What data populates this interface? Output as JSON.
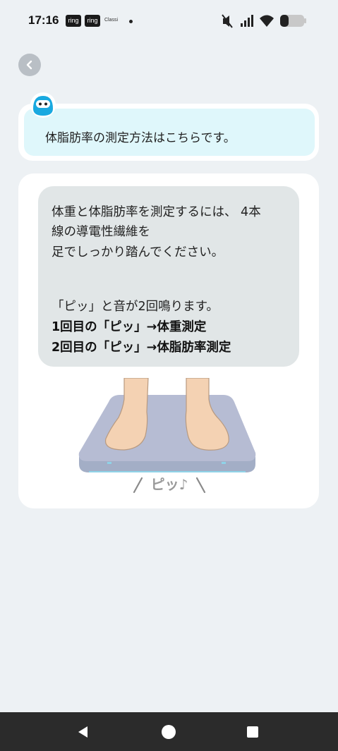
{
  "status_bar": {
    "time": "17:16",
    "badges": [
      "ring",
      "ring"
    ],
    "classi": "Classi"
  },
  "navigation": {
    "back_icon": "chevron-left-icon"
  },
  "bot": {
    "message": "体脂肪率の測定方法はこちらです。"
  },
  "instructions": {
    "line1": "体重と体脂肪率を測定するには、 4本",
    "line2": "線の導電性繊維を",
    "line3": "足でしっかり踏んでください。",
    "line4": "「ピッ」と音が2回鳴ります。",
    "line5": "1回目の「ピッ」→体重測定",
    "line6": "2回目の「ピッ」→体脂肪率測定"
  },
  "illustration": {
    "sound_label": "ピッ♪"
  },
  "colors": {
    "background": "#edf1f4",
    "bot_bubble": "#dff7fb",
    "instruction_bubble": "#e1e6e7",
    "scale": "#b6bcd3",
    "skin": "#f4d2b3"
  }
}
